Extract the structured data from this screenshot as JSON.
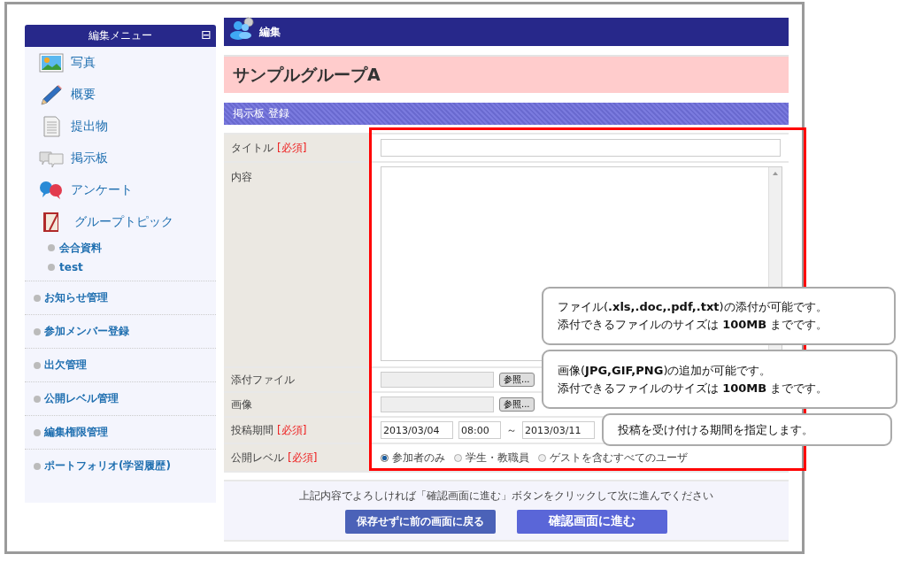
{
  "sidebar": {
    "header": "編集メニュー",
    "collapse_icon": "⊟",
    "items": [
      {
        "kind": "icon-link",
        "label": "写真"
      },
      {
        "kind": "icon-link",
        "label": "概要"
      },
      {
        "kind": "icon-link",
        "label": "提出物"
      },
      {
        "kind": "icon-link",
        "label": "掲示板"
      },
      {
        "kind": "icon-link",
        "label": "アンケート"
      },
      {
        "kind": "icon-link",
        "label": "グループトピック"
      },
      {
        "kind": "sub-link",
        "label": "会合資料"
      },
      {
        "kind": "sub-link",
        "label": "test"
      },
      {
        "kind": "menu-link",
        "label": "お知らせ管理"
      },
      {
        "kind": "menu-link",
        "label": "参加メンバー登録"
      },
      {
        "kind": "menu-link",
        "label": "出欠管理"
      },
      {
        "kind": "menu-link",
        "label": "公開レベル管理"
      },
      {
        "kind": "menu-link",
        "label": "編集権限管理"
      },
      {
        "kind": "menu-link",
        "label": "ポートフォリオ(学習履歴)"
      }
    ]
  },
  "header": {
    "title": "編集"
  },
  "group_title": "サンプルグループA",
  "section_title": "掲示板 登録",
  "form": {
    "rows": [
      {
        "kind": "text",
        "label": "タイトル",
        "required": "[必須]"
      },
      {
        "kind": "textarea",
        "label": "内容"
      },
      {
        "kind": "file",
        "label": "添付ファイル",
        "button": "参照..."
      },
      {
        "kind": "file",
        "label": "画像",
        "button": "参照..."
      },
      {
        "kind": "period",
        "label": "投稿期間",
        "required": "[必須]",
        "start_date": "2013/03/04",
        "start_time": "08:00",
        "separator": "～",
        "end_date": "2013/03/11"
      },
      {
        "kind": "radio",
        "label": "公開レベル",
        "required": "[必須]",
        "options": [
          {
            "label": "参加者のみ",
            "selected": true
          },
          {
            "label": "学生・教職員",
            "selected": false
          },
          {
            "label": "ゲストを含むすべてのユーザ",
            "selected": false
          }
        ]
      }
    ]
  },
  "footer": {
    "note": "上記内容でよろしければ「確認画面に進む」ボタンをクリックして次に進んでください",
    "buttons": [
      {
        "kind": "back",
        "label": "保存せずに前の画面に戻る"
      },
      {
        "kind": "next",
        "label": "確認画面に進む"
      }
    ]
  },
  "callouts": [
    {
      "lines": [
        "ファイル(**.xls,.doc,.pdf,.txt**)の添付が可能です。",
        "添付できるファイルのサイズは **100MB** までです。"
      ]
    },
    {
      "lines": [
        "画像(**JPG,GIF,PNG**)の追加が可能です。",
        "添付できるファイルのサイズは **100MB** までです。"
      ]
    },
    {
      "lines": [
        "投稿を受け付ける期間を指定します。"
      ]
    }
  ]
}
